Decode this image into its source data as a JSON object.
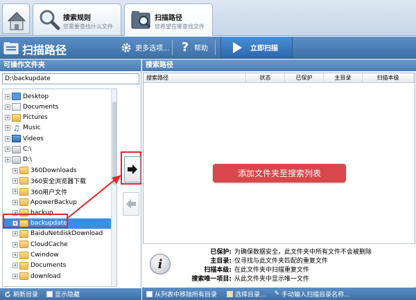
{
  "tabs": [
    {
      "title": "搜索规则",
      "subtitle": "您需要查找什么文件"
    },
    {
      "title": "扫描路径",
      "subtitle": "您希望在哪查找文件"
    }
  ],
  "header": {
    "title": "扫描路径",
    "more_label": "更多选项...",
    "help_label": "帮助",
    "scan_label": "立即扫描"
  },
  "left_panel": {
    "title": "可操作文件夹",
    "path_value": "D:\\backupdate",
    "tree": [
      {
        "label": "Desktop",
        "icon": "desktop-icon",
        "level": 0
      },
      {
        "label": "Documents",
        "icon": "documents-icon",
        "level": 0
      },
      {
        "label": "Pictures",
        "icon": "pictures-icon",
        "level": 0
      },
      {
        "label": "Music",
        "icon": "music-icon",
        "level": 0
      },
      {
        "label": "Videos",
        "icon": "videos-icon",
        "level": 0
      },
      {
        "label": "C:\\",
        "icon": "drive-icon",
        "level": 0
      },
      {
        "label": "D:\\",
        "icon": "drive-icon",
        "level": 0
      },
      {
        "label": "360Downloads",
        "icon": "folder-icon",
        "level": 1
      },
      {
        "label": "360安全浏览器下载",
        "icon": "folder-icon",
        "level": 1
      },
      {
        "label": "360用户文件",
        "icon": "folder-icon",
        "level": 1
      },
      {
        "label": "ApowerBackup",
        "icon": "folder-icon",
        "level": 1
      },
      {
        "label": "backup",
        "icon": "folder-icon",
        "level": 1
      },
      {
        "label": "backupdate",
        "icon": "folder-icon",
        "level": 1,
        "selected": true
      },
      {
        "label": "BaiduNetdiskDownload",
        "icon": "folder-icon",
        "level": 1
      },
      {
        "label": "CloudCache",
        "icon": "folder-icon",
        "level": 1
      },
      {
        "label": "Cwindow",
        "icon": "folder-icon",
        "level": 1
      },
      {
        "label": "Documents",
        "icon": "folder-icon",
        "level": 1
      },
      {
        "label": "download",
        "icon": "folder-icon",
        "level": 1
      }
    ]
  },
  "right_panel": {
    "title": "搜索路径",
    "columns": [
      "搜索路径",
      "状态",
      "已保护",
      "主目录",
      "扫描本级"
    ],
    "tooltip": "添加文件夹至搜索列表",
    "info": [
      {
        "key": "已保护:",
        "value": "为确保数据安全，此文件夹中所有文件不会被删除"
      },
      {
        "key": "主目录:",
        "value": "仅寻找与此文件夹匹配的重复文件"
      },
      {
        "key": "扫描本级:",
        "value": "在此文件夹中扫描重复文件"
      },
      {
        "key": "搜索唯一项目:",
        "value": "从此文件夹中显示唯一文件"
      }
    ]
  },
  "bottom_left": {
    "refresh_label": "刷新目录",
    "show_hidden_label": "显示隐藏"
  },
  "bottom_right": {
    "remove_all_label": "从列表中移除所有目录",
    "select_dir_label": "选择目录...",
    "manual_input_label": "手动输入扫描目录名称..."
  },
  "colors": {
    "header_blue": "#3d70a8",
    "selection_blue": "#3a8ee6",
    "annotation_red": "#e0262a",
    "tooltip_red": "#d9474c"
  }
}
